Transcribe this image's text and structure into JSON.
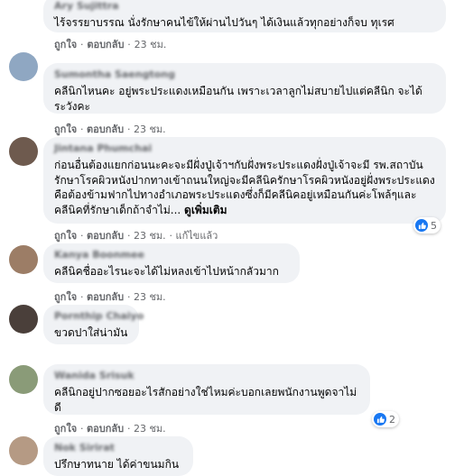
{
  "labels": {
    "like": "ถูกใจ",
    "reply": "ตอบกลับ",
    "separator": "·",
    "see_more": "ดูเพิ่มเติม",
    "edited": "แก้ไขแล้ว"
  },
  "comments": [
    {
      "author": "Ary Sujittra",
      "text": "ไร้จรรยาบรรณ นั่งรักษาคนไข้ให้ผ่านไปวันๆ ได้เงินแล้วทุกอย่างก็จบ ทุเรศ",
      "time": "23 ชม."
    },
    {
      "author": "Sumontha Saengtong",
      "text": "คลีนิกไหนคะ อยู่พระประแดงเหมือนกัน เพราะเวลาลูกไม่สบายไปแต่คลีนิก จะได้ระวังคะ",
      "time": "23 ชม."
    },
    {
      "author": "Jintana Phumchai",
      "text": "ก่อนอื่นต้องแยกก่อนนะคะจะมีฝั่งปู่เจ้าฯกับฝั่งพระประแดงฝั่งปู่เจ้าจะมี รพ.สถาบันรักษาโรคผิวหนังปากทางเข้าถนนใหญ่จะมีคลีนิครักษาโรคผิวหนังอยู่ฝั่งพระประแดงคือต้องข้ามฟากไปทางอำเภอพระประแดงซึ่งก็มีคลีนิคอยู่เหมือนกันค่ะโพล้ๆและคลีนิคที่รักษาเด็กถ้าจำไม่...",
      "time": "23 ชม.",
      "reactions": "5"
    },
    {
      "author": "Kanya Boonmee",
      "text": "คลีนิคชื่ออะไรนะจะได้ไม่หลงเข้าไปหน้ากลัวมาก",
      "time": "23 ชม."
    },
    {
      "author": "Pornthip Chaiyo",
      "text": "ขวดปาใส่น่ามัน"
    },
    {
      "author": "Wanida Srisuk",
      "text": "คลีนิกอยู่ปากซอยอะไรสักอย่างใช่ไหมค่ะบอกเลยพนักงานพูดจาไม่ดี",
      "time": "23 ชม.",
      "reactions": "2"
    },
    {
      "author": "Nok Sirirat",
      "text": "ปรึกษาทนาย ได้ค่าขนมกิน"
    }
  ],
  "colors": {
    "bubble_bg": "#f0f2f5",
    "meta_text": "#65676b",
    "text": "#050505",
    "like_blue": "#1877f2"
  }
}
